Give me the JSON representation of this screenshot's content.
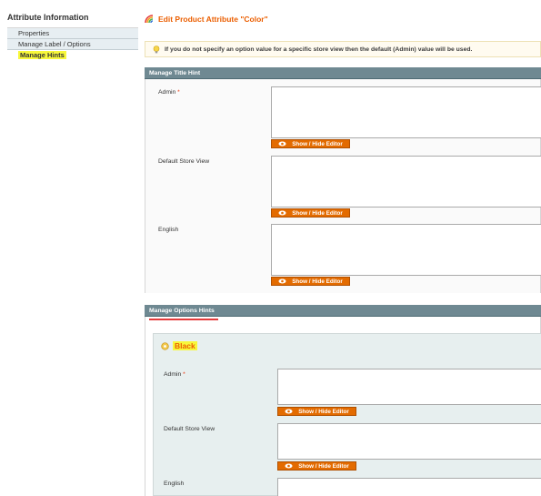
{
  "sidebar": {
    "title": "Attribute Information",
    "items": [
      {
        "label": "Properties"
      },
      {
        "label": "Manage Label / Options"
      },
      {
        "label": "Manage Hints"
      }
    ]
  },
  "page": {
    "title": "Edit Product Attribute \"Color\""
  },
  "notice": {
    "text": "If you do not specify an option value for a specific store view then the default (Admin) value will be used."
  },
  "title_hint": {
    "header": "Manage Title Hint",
    "fields": [
      {
        "label": "Admin",
        "required": "*",
        "button": "Show / Hide Editor"
      },
      {
        "label": "Default Store View",
        "button": "Show / Hide Editor"
      },
      {
        "label": "English",
        "button": "Show / Hide Editor"
      }
    ]
  },
  "options_hints": {
    "header": "Manage Options Hints",
    "option_name": "Black",
    "fields": [
      {
        "label": "Admin",
        "required": "*",
        "button": "Show / Hide Editor"
      },
      {
        "label": "Default Store View",
        "button": "Show / Hide Editor"
      },
      {
        "label": "English"
      }
    ]
  },
  "colors": {
    "accent": "#eb5e00",
    "button": "#e36b00",
    "section_header": "#6f8992",
    "highlight": "#f7f73b"
  }
}
